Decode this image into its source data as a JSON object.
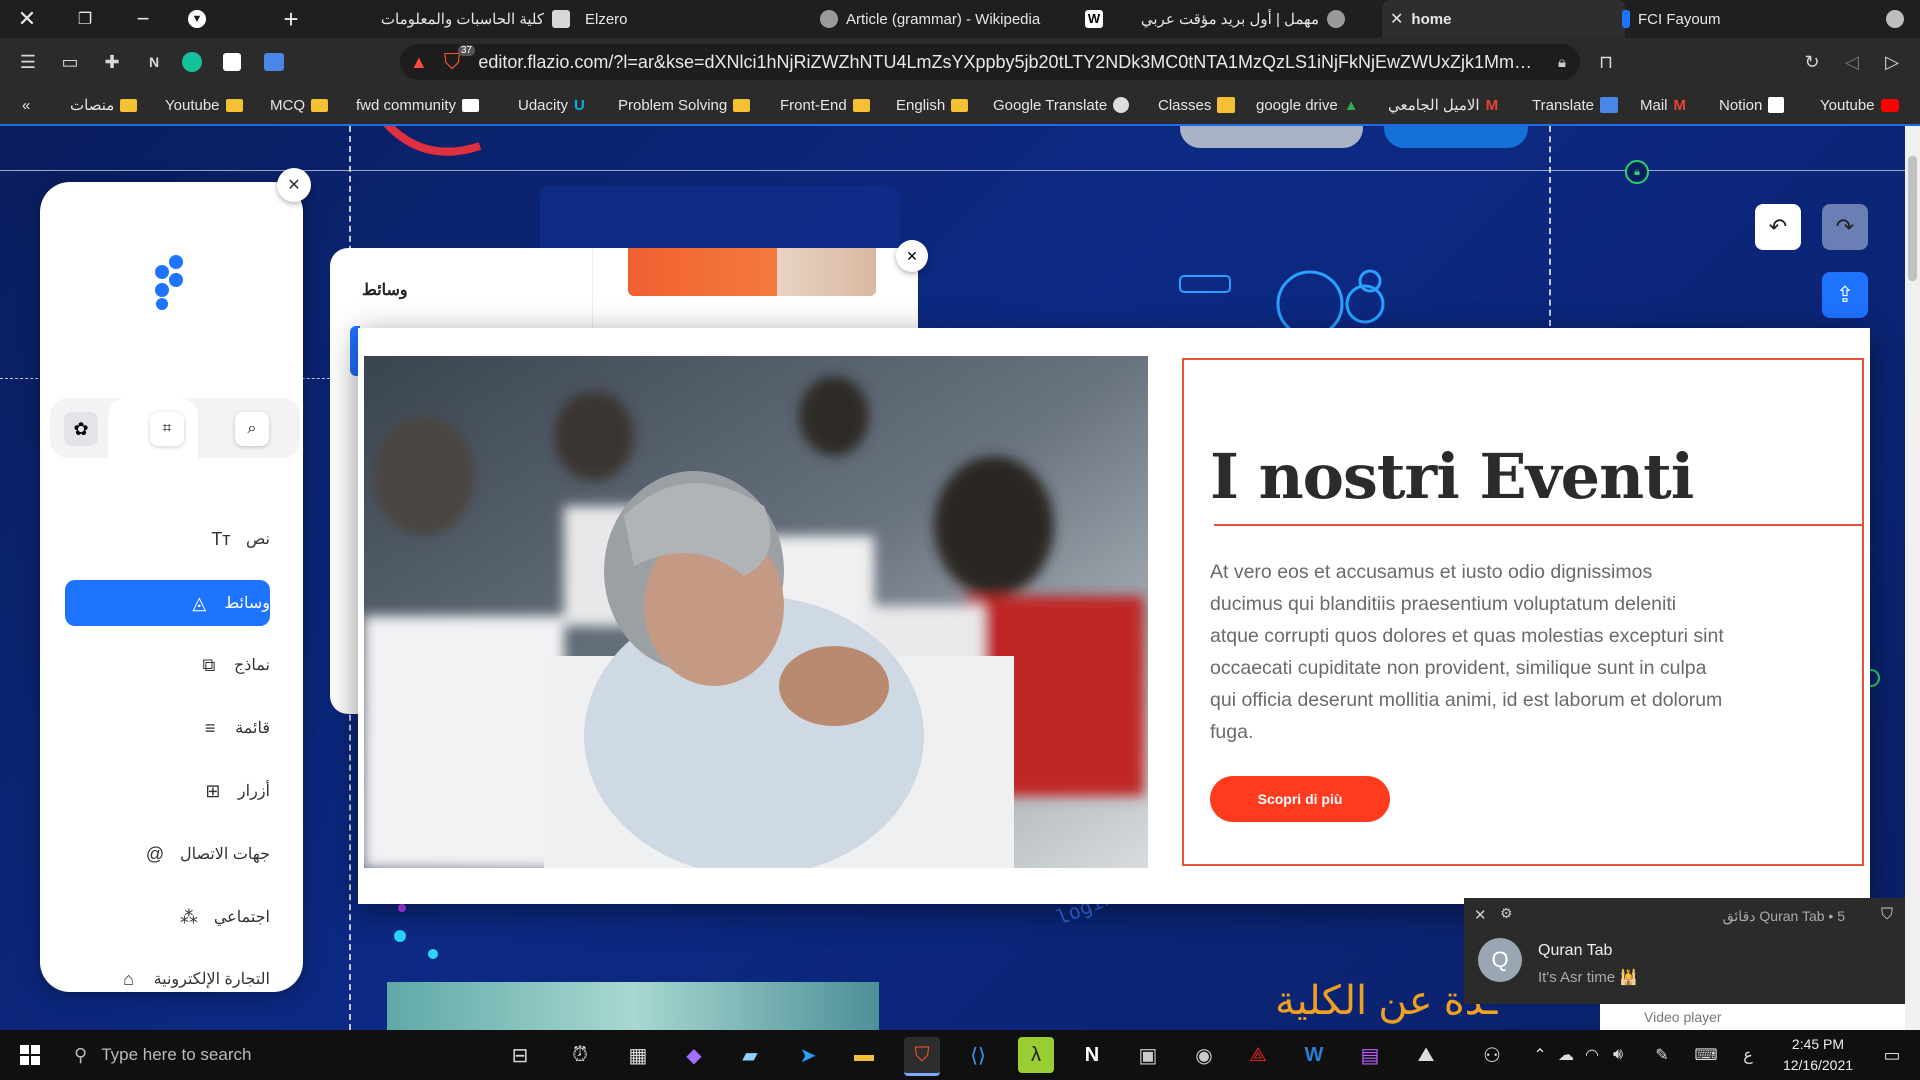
{
  "tabs": [
    {
      "label": "كلية الحاسبات والمعلومات"
    },
    {
      "label": "Elzero"
    },
    {
      "label": "Article (grammar) - Wikipedia"
    },
    {
      "label": "مهمل | أول بريد مؤقت عربي"
    },
    {
      "label": "home"
    },
    {
      "label": "FCI Fayoum"
    }
  ],
  "address": {
    "url": "editor.flazio.com/?l=ar&kse=dXNlci1hNjRiZWZhNTU4LmZsYXppby5jb20tLTY2NDk3MC0tNTA1MzQzLS1iNjFkNjEwZWUxZjk1MmNhY...",
    "shields_count": "37"
  },
  "bookmarks": [
    "منصات",
    "Youtube",
    "MCQ",
    "fwd community",
    "Udacity",
    "Problem Solving",
    "Front-End",
    "English",
    "Google Translate",
    "Classes",
    "google drive",
    "الاميل الجامعي",
    "Translate",
    "Mail",
    "Notion",
    "Youtube"
  ],
  "sidebar": {
    "items": [
      {
        "label": "نص",
        "icon": "Tт"
      },
      {
        "label": "وسائط",
        "icon": "◬"
      },
      {
        "label": "نماذج",
        "icon": "⧉"
      },
      {
        "label": "قائمة",
        "icon": "≡"
      },
      {
        "label": "أزرار",
        "icon": "⊞"
      },
      {
        "label": "جهات الاتصال",
        "icon": "@"
      },
      {
        "label": "اجتماعي",
        "icon": "⁂"
      },
      {
        "label": "التجارة الإلكترونية",
        "icon": "⌂"
      }
    ],
    "active_index": 1
  },
  "media_panel": {
    "title": "وسائط"
  },
  "modal": {
    "title": "I nostri Eventi",
    "body": "At vero eos et accusamus et iusto odio dignissimos ducimus qui blanditiis praesentium voluptatum deleniti atque corrupti quos dolores et quas molestias excepturi sint occaecati cupiditate non provident, similique sunt in culpa qui officia deserunt mollitia animi, id est laborum et dolorum fuga.",
    "button": "Scopri di più"
  },
  "background_heading": "ـذة عن الكلية",
  "background_snippet": "login : identific",
  "notification": {
    "app": "Quran Tab",
    "time": "5 دقائق",
    "title": "Quran Tab",
    "message": "It's Asr time 🕌",
    "avatar": "Q",
    "hidden_text": "Video player"
  },
  "taskbar": {
    "search_placeholder": "Type here to search",
    "time": "2:45 PM",
    "date": "12/16/2021",
    "lang": "ع"
  },
  "colors": {
    "accent": "#1e73ff",
    "event_red": "#ff3b1f",
    "canvas": "#0b1f66"
  }
}
